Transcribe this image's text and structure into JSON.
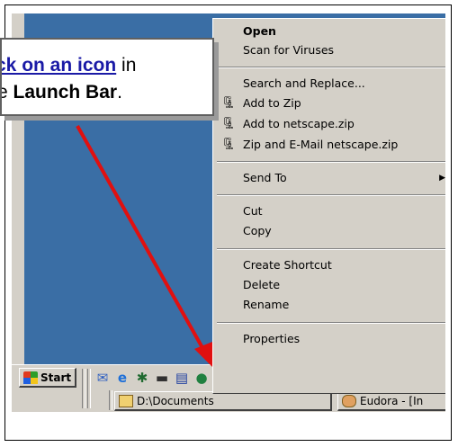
{
  "callout": {
    "prefix_link": "ck on an icon",
    "line1_suffix": " in",
    "line2_prefix": "",
    "line2_bold": "Launch Bar",
    "line2_end": ".",
    "line2_cut": "e",
    "arrow_color": "#e01010"
  },
  "context_menu": {
    "items": [
      {
        "label": "Open",
        "bold": true,
        "icon": null
      },
      {
        "label": "Scan for Viruses",
        "icon": null
      },
      {
        "label": "Search and Replace...",
        "icon": null
      },
      {
        "label": "Add to Zip",
        "icon": "winzip-icon"
      },
      {
        "label": "Add to netscape.zip",
        "icon": "winzip-icon"
      },
      {
        "label": "Zip and E-Mail netscape.zip",
        "icon": "winzip-mail-icon"
      },
      {
        "label": "Send To",
        "icon": null,
        "submenu": true
      },
      {
        "label": "Cut",
        "icon": null
      },
      {
        "label": "Copy",
        "icon": null
      },
      {
        "label": "Create Shortcut",
        "icon": null
      },
      {
        "label": "Delete",
        "icon": null
      },
      {
        "label": "Rename",
        "icon": null
      },
      {
        "label": "Properties",
        "icon": null
      }
    ]
  },
  "taskbar": {
    "start_label": "Start",
    "quick_launch": [
      "outlook-express-icon",
      "internet-explorer-icon",
      "netscape-icon",
      "mail-icon",
      "desktop-icon",
      "network-icon",
      "email-icon",
      "pencil-icon",
      "media-icon",
      "paint-icon"
    ],
    "tasks": [
      {
        "label": "D:\\Documents",
        "icon": "folder-icon"
      },
      {
        "label": "Eudora - [In",
        "icon": "eudora-icon"
      }
    ]
  },
  "colors": {
    "desktop": "#3a6ea5",
    "menu_bg": "#d4d0c8"
  }
}
